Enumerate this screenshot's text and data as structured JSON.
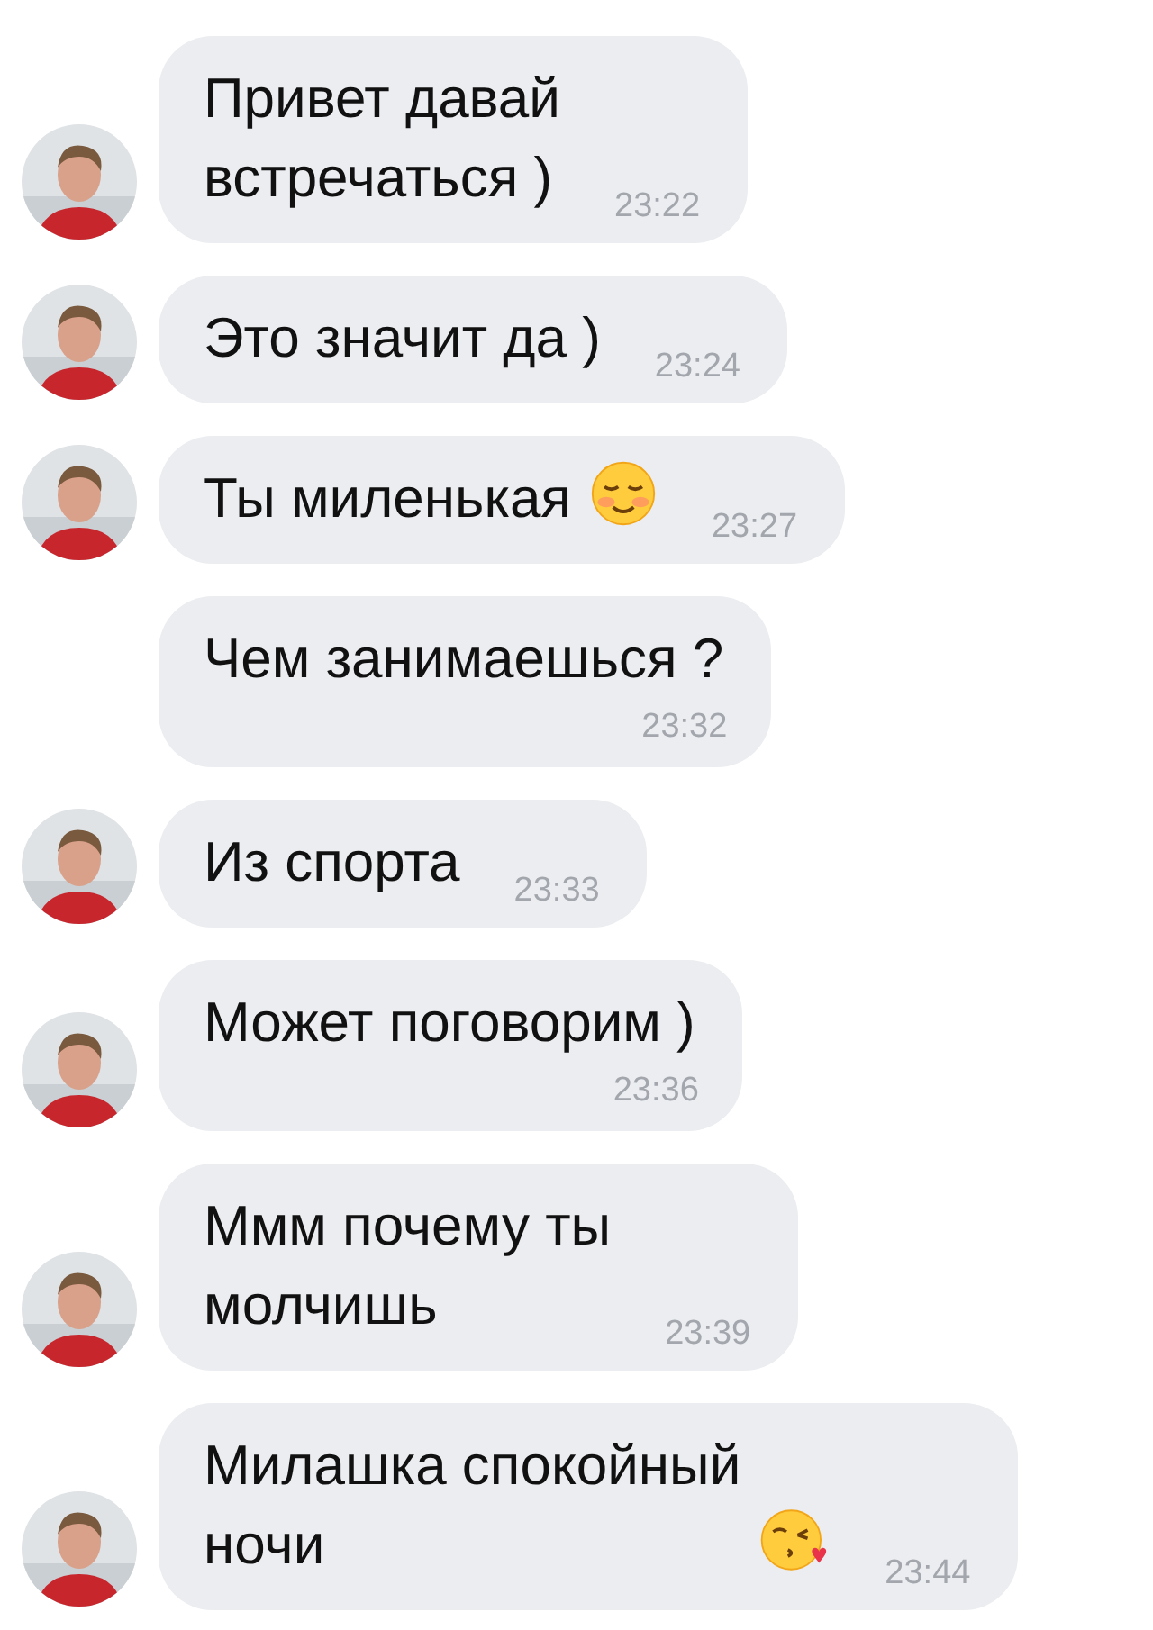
{
  "messages": [
    {
      "text": "Привет давай\nвстречаться )",
      "time": "23:22",
      "avatar": true,
      "kind": "inline"
    },
    {
      "text": "Это значит да )",
      "time": "23:24",
      "avatar": true,
      "kind": "inline"
    },
    {
      "text": "Ты миленькая",
      "emoji": {
        "kind": "blush"
      },
      "time": "23:27",
      "avatar": true,
      "kind": "inline"
    },
    {
      "text": "Чем занимаешься ?",
      "time": "23:32",
      "avatar": false,
      "kind": "below"
    },
    {
      "text": "Из спорта",
      "time": "23:33",
      "avatar": true,
      "kind": "inline"
    },
    {
      "text": "Может поговорим )",
      "time": "23:36",
      "avatar": true,
      "kind": "below"
    },
    {
      "text": "Ммм почему ты\nмолчишь",
      "time": "23:39",
      "avatar": true,
      "kind": "inline"
    },
    {
      "text": "Милашка спокойный\nночи",
      "emoji": {
        "kind": "kiss"
      },
      "time": "23:44",
      "avatar": true,
      "kind": "inline"
    }
  ]
}
